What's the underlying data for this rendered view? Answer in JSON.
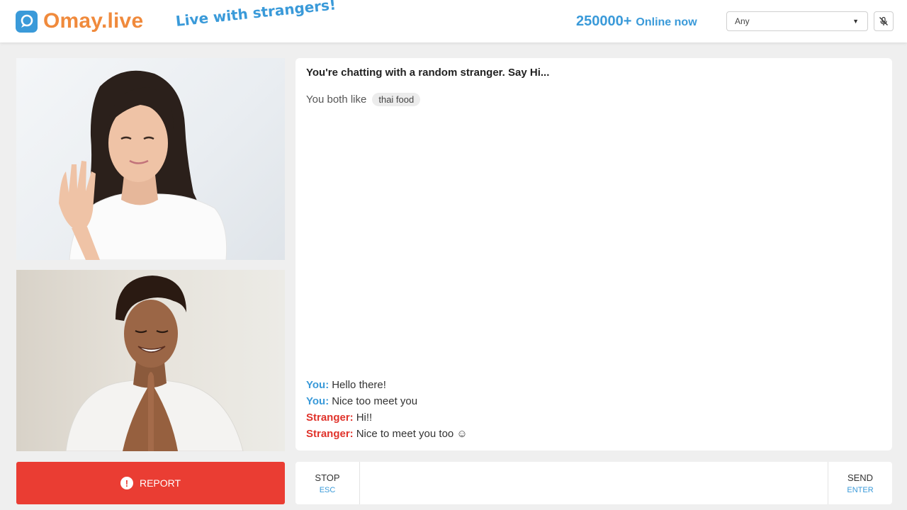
{
  "header": {
    "logo_text": "Omay.live",
    "tagline": "Live with strangers!",
    "online_count": "250000+",
    "online_label": "Online now",
    "filter_select": {
      "selected": "Any"
    },
    "mic_icon": "mic-off-icon"
  },
  "chat": {
    "intro": "You're chatting with a random stranger. Say Hi...",
    "likes_label": "You both like",
    "interest": "thai food",
    "messages": [
      {
        "sender": "You:",
        "text": "Hello there!"
      },
      {
        "sender": "You:",
        "text": "Nice too meet you"
      },
      {
        "sender": "Stranger:",
        "text": "Hi!!"
      },
      {
        "sender": "Stranger:",
        "text": "Nice to meet you too ☺"
      }
    ]
  },
  "controls": {
    "report_label": "REPORT",
    "stop_label": "STOP",
    "stop_hint": "ESC",
    "send_label": "SEND",
    "send_hint": "ENTER",
    "message_placeholder": ""
  },
  "colors": {
    "brand_blue": "#3a9ad9",
    "brand_orange": "#f08a3c",
    "report_red": "#ea3d33",
    "stranger_red": "#e0332b"
  }
}
